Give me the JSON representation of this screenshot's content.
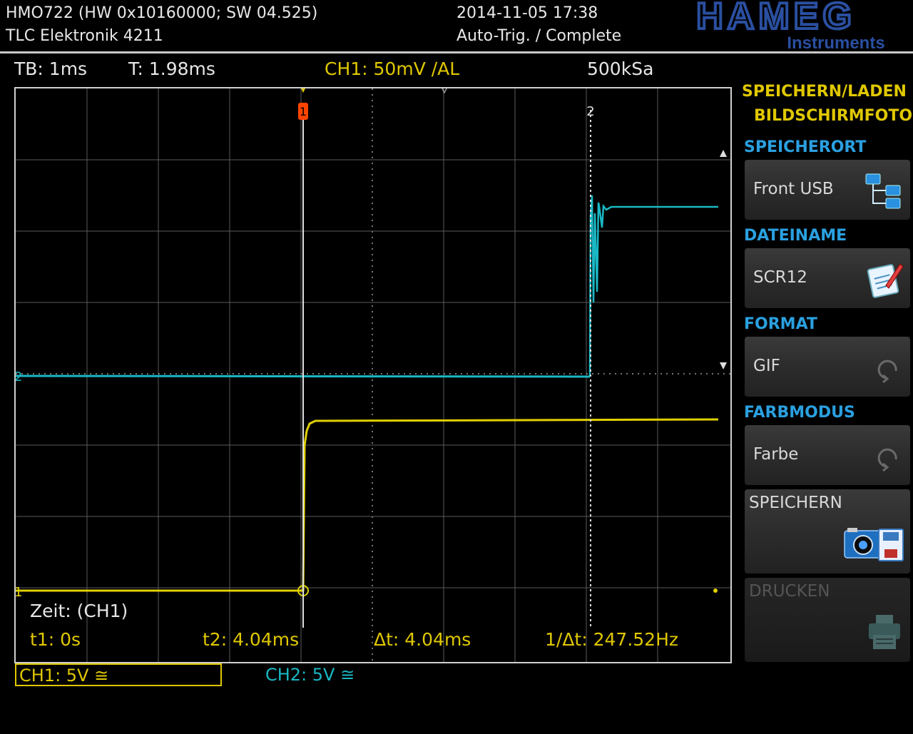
{
  "header": {
    "device": "HMO722 (HW 0x10160000; SW 04.525)",
    "owner": "TLC Elektronik 4211",
    "datetime": "2014-11-05 17:38",
    "trigger_status": "Auto-Trig. / Complete",
    "brand": "HAMEG",
    "brand_sub": "Instruments"
  },
  "info_bar": {
    "timebase": "TB: 1ms",
    "trigger_time": "T: 1.98ms",
    "ch1_trigger": "CH1: 50mV ∕AL",
    "sample_rate": "500kSa"
  },
  "waveform": {
    "colors": {
      "ch1": "#e0d000",
      "ch2": "#1ab8c4",
      "grid": "#707070",
      "cursor": "#e0e0e0",
      "marker": "#ff3300"
    },
    "cursor_labels": [
      "1",
      "2"
    ],
    "channel_markers": [
      "1",
      "2"
    ]
  },
  "measurements": {
    "title": "Zeit: (CH1)",
    "t1": "t1: 0s",
    "t2": "t2: 4.04ms",
    "dt": "Δt: 4.04ms",
    "freq": "1/Δt: 247.52Hz"
  },
  "channels": {
    "ch1": "CH1: 5V ≅",
    "ch2": "CH2: 5V ≅"
  },
  "menu": {
    "title1": "SPEICHERN/LADEN",
    "title2": "BILDSCHIRMFOTO",
    "storage_label": "SPEICHERORT",
    "storage_value": "Front USB",
    "filename_label": "DATEINAME",
    "filename_value": "SCR12",
    "format_label": "FORMAT",
    "format_value": "GIF",
    "color_label": "FARBMODUS",
    "color_value": "Farbe",
    "save_label": "SPEICHERN",
    "print_label": "DRUCKEN"
  },
  "icons": {
    "storage": "folder-tree-icon",
    "filename": "clipboard-edit-icon",
    "format": "cycle-icon",
    "color": "cycle-icon",
    "save": "camera-save-icon",
    "print": "printer-icon"
  }
}
